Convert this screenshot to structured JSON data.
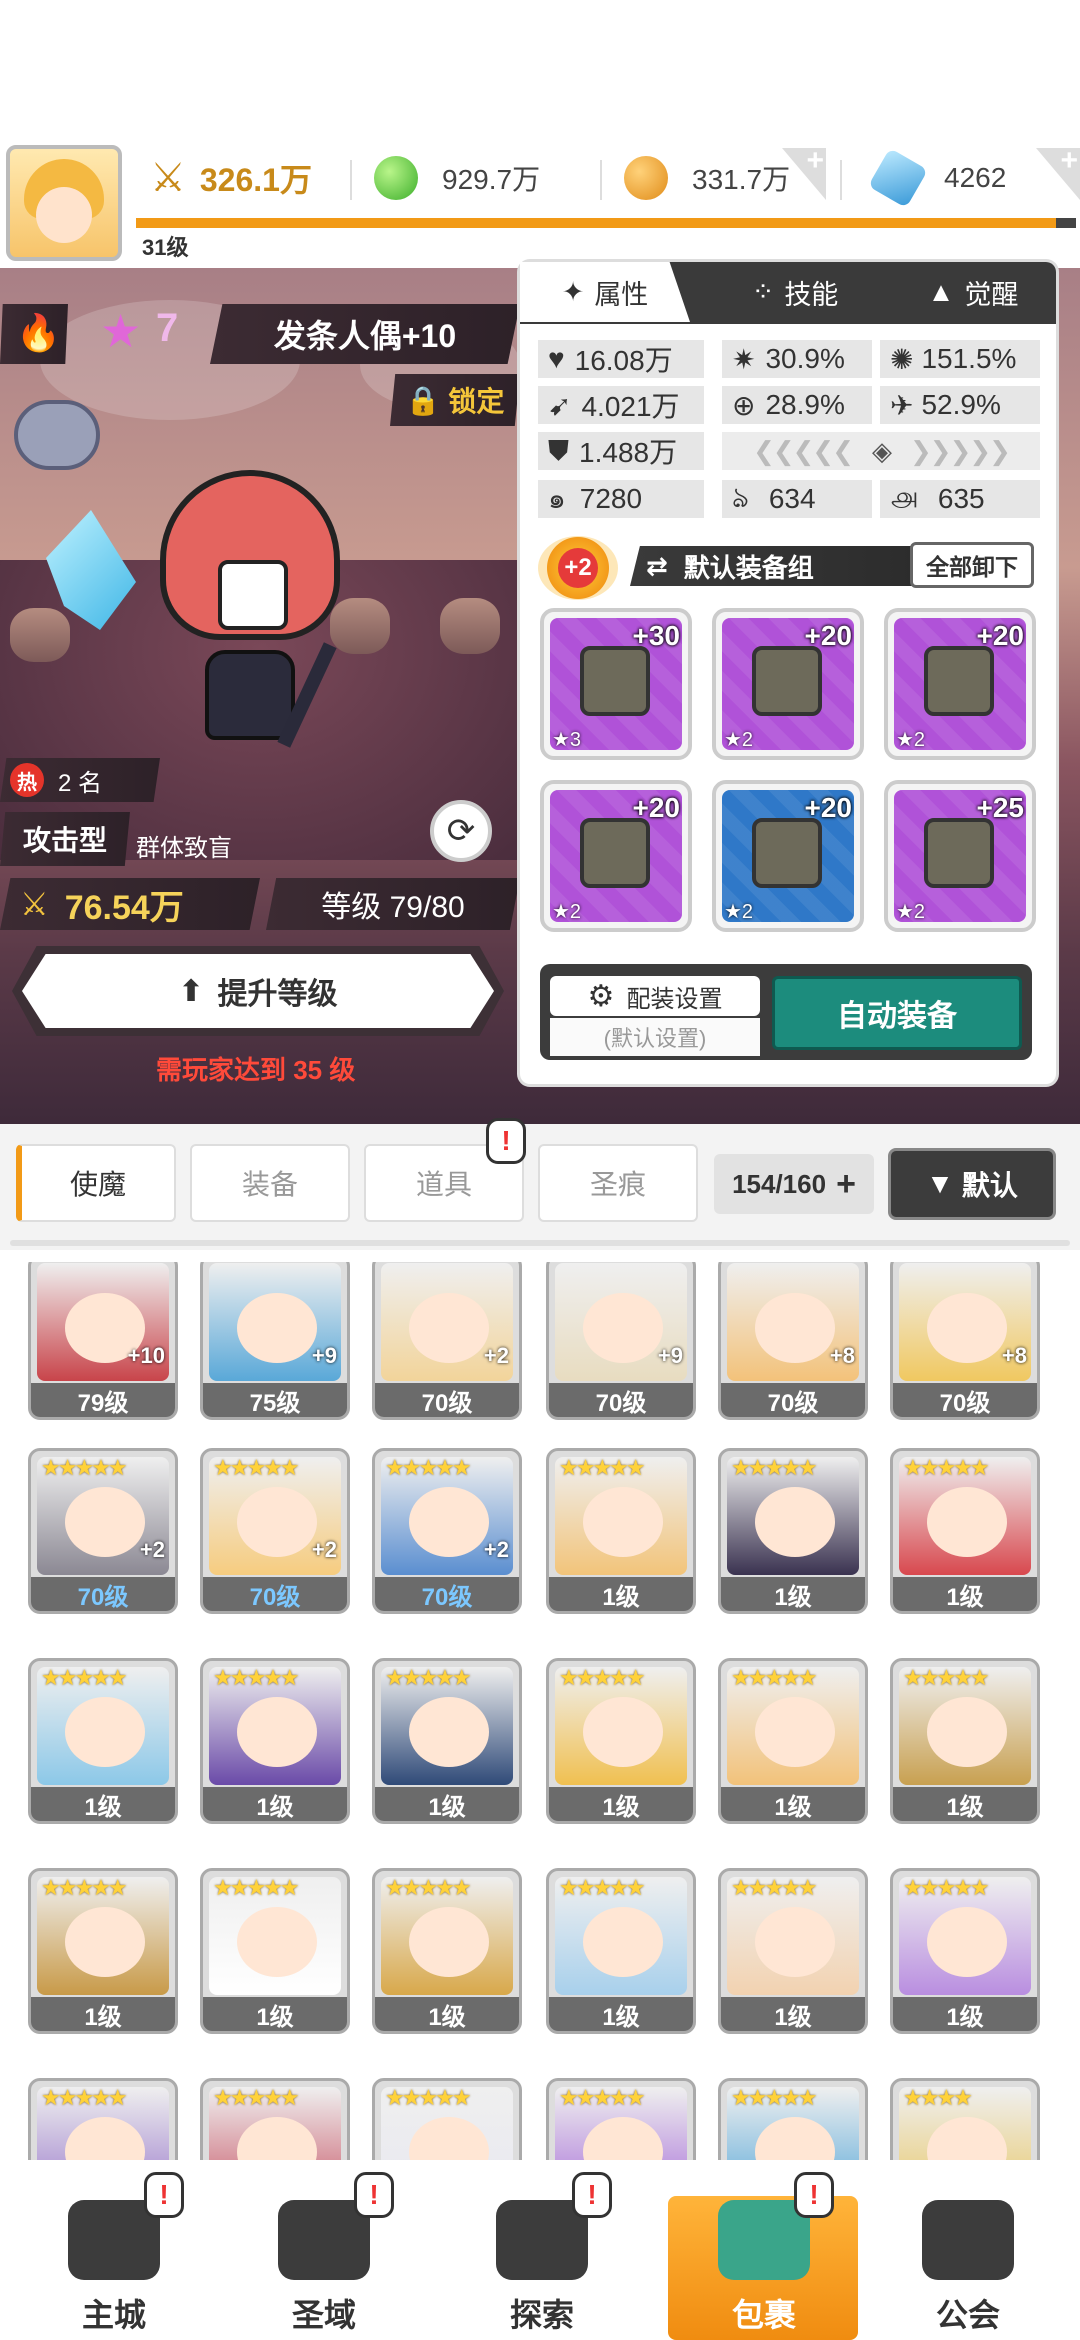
{
  "header": {
    "player_level": "31级",
    "power": "326.1万",
    "gold_green": "929.7万",
    "gold": "331.7万",
    "diamond": "4262",
    "plus": "+"
  },
  "hero": {
    "star_count": "7",
    "name": "发条人偶+10",
    "lock_label": "锁定",
    "hot_label": "热",
    "hot_rank": "2 名",
    "type": "攻击型",
    "skill_tag": "群体致盲",
    "power": "76.54万",
    "level": "等级 79/80",
    "upgrade_label": "提升等级",
    "requirement": "需玩家达到 35 级",
    "fire_icon": "fire-icon",
    "star_icon": "★"
  },
  "panel": {
    "tabs": [
      "属性",
      "技能",
      "觉醒"
    ],
    "stats": {
      "hp": "16.08万",
      "crit": "30.9%",
      "crit_dmg": "151.5%",
      "atk": "4.021万",
      "hit": "28.9%",
      "dodge": "52.9%",
      "def": "1.488万",
      "speed": "7280",
      "pen": "634",
      "res": "635"
    },
    "set_badge": "+2",
    "set_name": "默认装备组",
    "unequip_all": "全部卸下",
    "equipment": [
      {
        "level": "+30",
        "stars": "★3",
        "slot": "sword",
        "color": "#b052d8"
      },
      {
        "level": "+20",
        "stars": "★2",
        "slot": "helmet",
        "color": "#b052d8"
      },
      {
        "level": "+20",
        "stars": "★2",
        "slot": "armor",
        "color": "#b052d8"
      },
      {
        "level": "+20",
        "stars": "★2",
        "slot": "belt",
        "color": "#b052d8"
      },
      {
        "level": "+20",
        "stars": "★2",
        "slot": "necklace",
        "color": "#2f78c8"
      },
      {
        "level": "+25",
        "stars": "★2",
        "slot": "boots",
        "color": "#b052d8"
      }
    ],
    "config_label": "配装设置",
    "config_sub": "(默认设置)",
    "auto_equip": "自动装备"
  },
  "filter": {
    "tabs": [
      "使魔",
      "装备",
      "道具",
      "圣痕"
    ],
    "count": "154/160",
    "sort": "默认",
    "alert": "!"
  },
  "roster": [
    {
      "level": "79级",
      "plus": "+10",
      "color": "#c8444a",
      "blue": false,
      "partial": true
    },
    {
      "level": "75级",
      "plus": "+9",
      "color": "#59a8d8",
      "blue": false,
      "partial": true
    },
    {
      "level": "70级",
      "plus": "+2",
      "color": "#f2d49a",
      "blue": false,
      "partial": true
    },
    {
      "level": "70级",
      "plus": "+9",
      "color": "#e8dcc0",
      "blue": false,
      "partial": true
    },
    {
      "level": "70级",
      "plus": "+8",
      "color": "#f3c27a",
      "blue": false,
      "partial": true
    },
    {
      "level": "70级",
      "plus": "+8",
      "color": "#f0c860",
      "blue": false,
      "partial": true
    },
    {
      "level": "70级",
      "plus": "+2",
      "color": "#8b8893",
      "blue": true,
      "stars": "★★★★★"
    },
    {
      "level": "70级",
      "plus": "+2",
      "color": "#f6cc7f",
      "blue": true,
      "stars": "★★★★★"
    },
    {
      "level": "70级",
      "plus": "+2",
      "color": "#5a8ed0",
      "blue": true,
      "stars": "★★★★★"
    },
    {
      "level": "1级",
      "plus": "",
      "color": "#f2c47a",
      "blue": false,
      "stars": "★★★★★"
    },
    {
      "level": "1级",
      "plus": "",
      "color": "#3a3250",
      "blue": false,
      "stars": "★★★★★"
    },
    {
      "level": "1级",
      "plus": "",
      "color": "#d8484e",
      "blue": false,
      "stars": "★★★★★"
    },
    {
      "level": "1级",
      "plus": "",
      "color": "#8cc8e8",
      "blue": false,
      "stars": "★★★★★"
    },
    {
      "level": "1级",
      "plus": "",
      "color": "#6a4aa8",
      "blue": false,
      "stars": "★★★★★"
    },
    {
      "level": "1级",
      "plus": "",
      "color": "#2f4a78",
      "blue": false,
      "stars": "★★★★★"
    },
    {
      "level": "1级",
      "plus": "",
      "color": "#f0c050",
      "blue": false,
      "stars": "★★★★★"
    },
    {
      "level": "1级",
      "plus": "",
      "color": "#f2c27a",
      "blue": false,
      "stars": "★★★★★"
    },
    {
      "level": "1级",
      "plus": "",
      "color": "#c8a050",
      "blue": false,
      "stars": "★★★★★"
    },
    {
      "level": "1级",
      "plus": "",
      "color": "#c89a48",
      "blue": false,
      "stars": "★★★★★"
    },
    {
      "level": "1级",
      "plus": "",
      "color": "#ffffff",
      "blue": false,
      "stars": "★★★★★"
    },
    {
      "level": "1级",
      "plus": "",
      "color": "#d8a84a",
      "blue": false,
      "stars": "★★★★★"
    },
    {
      "level": "1级",
      "plus": "",
      "color": "#a8d0ec",
      "blue": false,
      "stars": "★★★★★"
    },
    {
      "level": "1级",
      "plus": "",
      "color": "#f2d2b0",
      "blue": false,
      "stars": "★★★★★"
    },
    {
      "level": "1级",
      "plus": "",
      "color": "#b98ee0",
      "blue": false,
      "stars": "★★★★★"
    },
    {
      "level": "",
      "plus": "",
      "color": "#9a7acb",
      "blue": false,
      "stars": "★★★★★"
    },
    {
      "level": "",
      "plus": "",
      "color": "#c85a6a",
      "blue": false,
      "stars": "★★★★★"
    },
    {
      "level": "",
      "plus": "",
      "color": "#e8e8f0",
      "blue": false,
      "stars": "★★★★★"
    },
    {
      "level": "",
      "plus": "",
      "color": "#a870d8",
      "blue": false,
      "stars": "★★★★★"
    },
    {
      "level": "",
      "plus": "",
      "color": "#58a8d8",
      "blue": false,
      "stars": "★★★★★"
    },
    {
      "level": "",
      "plus": "",
      "color": "#e8c86a",
      "blue": false,
      "stars": "★★★★"
    }
  ],
  "nav": [
    {
      "label": "主城",
      "alert": "!"
    },
    {
      "label": "圣域",
      "alert": "!"
    },
    {
      "label": "探索",
      "alert": "!"
    },
    {
      "label": "包裹",
      "alert": "!"
    },
    {
      "label": "公会",
      "alert": ""
    }
  ],
  "colors": {
    "accent": "#f29a16",
    "teal": "#1a8c7e",
    "dark": "#3c3c3c",
    "nav_active": "#f7a21b"
  }
}
